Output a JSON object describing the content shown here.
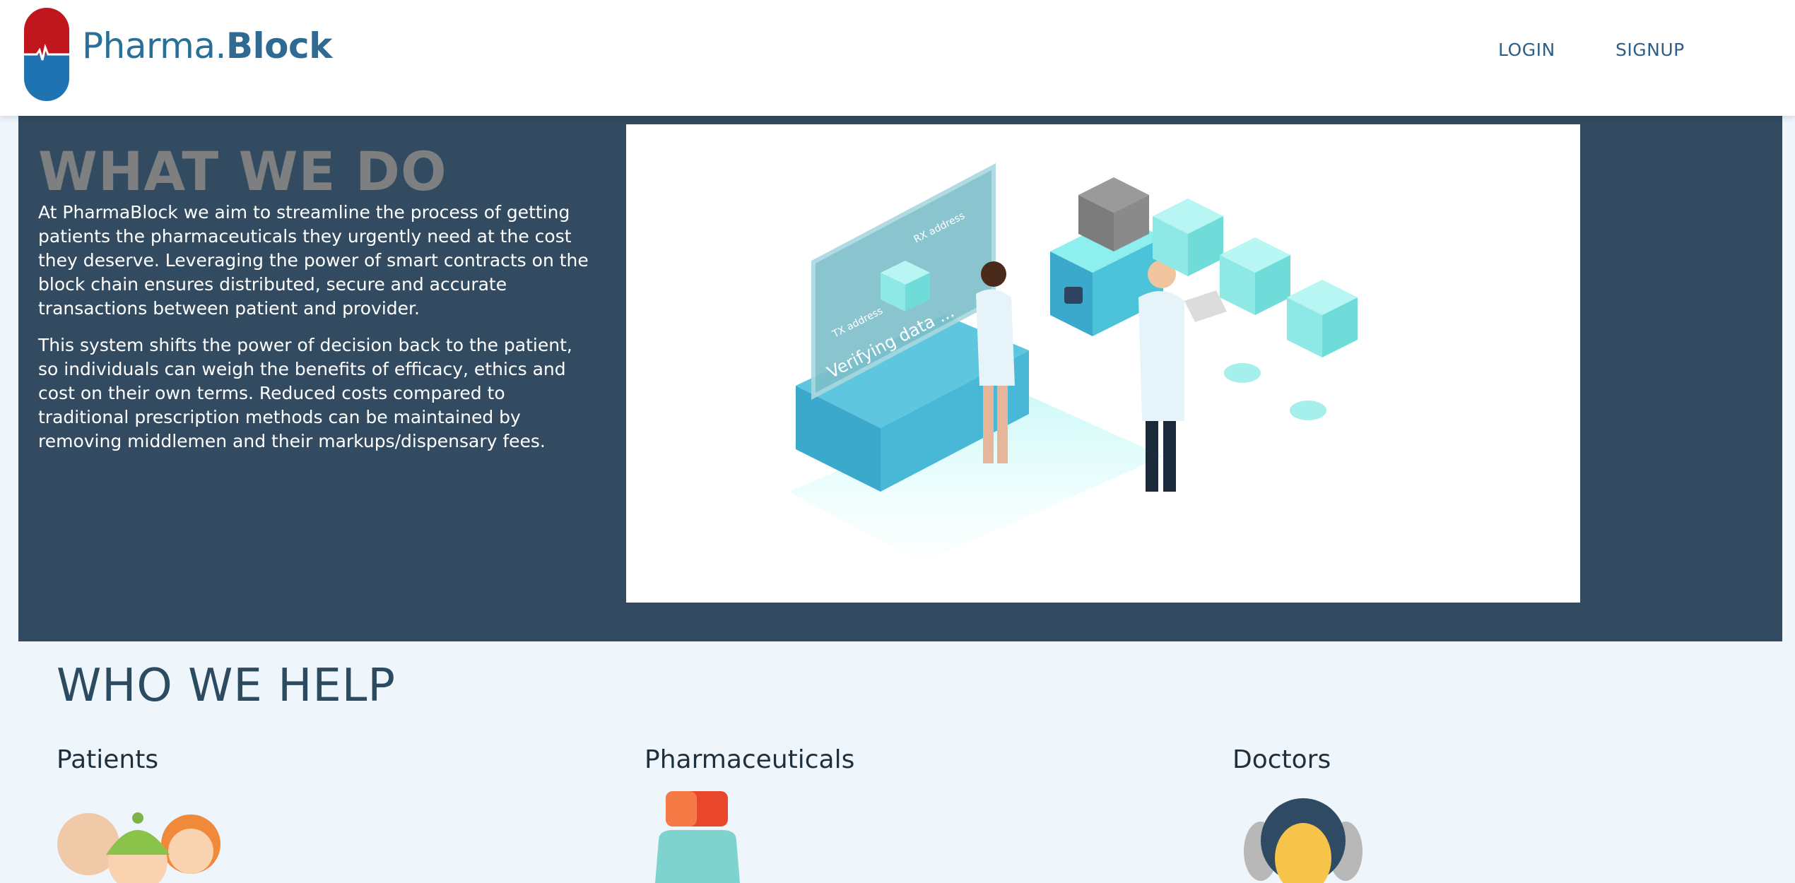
{
  "header": {
    "brand_prefix": "Pharma.",
    "brand_suffix": "Block",
    "nav": {
      "login": "LOGIN",
      "signup": "SIGNUP"
    }
  },
  "what_we_do": {
    "title": "WHAT WE DO",
    "paragraph1": "At PharmaBlock we aim to streamline the process of getting patients the pharmaceuticals they urgently need at the cost they deserve. Leveraging the power of smart contracts on the block chain ensures distributed, secure and accurate transactions between patient and provider.",
    "paragraph2": "This system shifts the power of decision back to the patient, so individuals can weigh the benefits of efficacy, ethics and cost on their own terms. Reduced costs compared to traditional prescription methods can be maintained by removing middlemen and their markups/dispensary fees.",
    "illustration": {
      "rx_label": "RX address",
      "tx_label": "TX address",
      "screen_text": "Verifying data ..."
    }
  },
  "who_we_help": {
    "title": "WHO WE HELP",
    "groups": [
      {
        "label": "Patients",
        "icon": "patients-group-icon"
      },
      {
        "label": "Pharmaceuticals",
        "icon": "medicine-bottle-icon"
      },
      {
        "label": "Doctors",
        "icon": "doctor-icon"
      }
    ]
  },
  "colors": {
    "header_bg": "#ffffff",
    "brand": "#2a6f97",
    "nav_link": "#2e5f87",
    "section_dark": "#324b61",
    "title_gray": "#7d7f80",
    "page_bg": "#eef6fc",
    "accent_teal": "#4cc3d9"
  }
}
